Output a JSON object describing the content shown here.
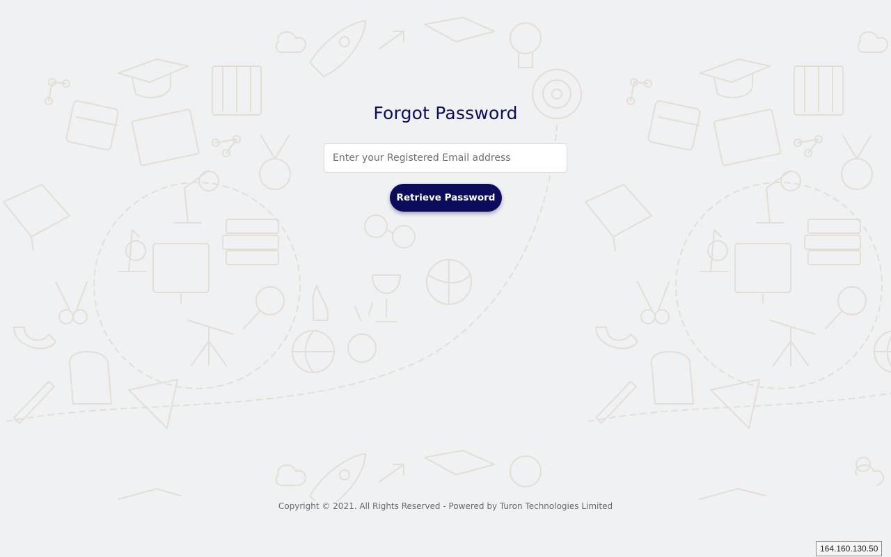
{
  "page": {
    "title": "Forgot Password",
    "background_color": "#f0f1f3",
    "accent_color": "#0c0c5c",
    "doodle_color": "#e3ded6"
  },
  "form": {
    "email_placeholder": "Enter your Registered Email address",
    "email_value": "",
    "submit_label": "Retrieve Password"
  },
  "footer": {
    "copyright": "Copyright © 2021. All Rights Reserved - Powered by Turon Technologies Limited"
  },
  "status": {
    "ip_address": "164.160.130.50"
  }
}
